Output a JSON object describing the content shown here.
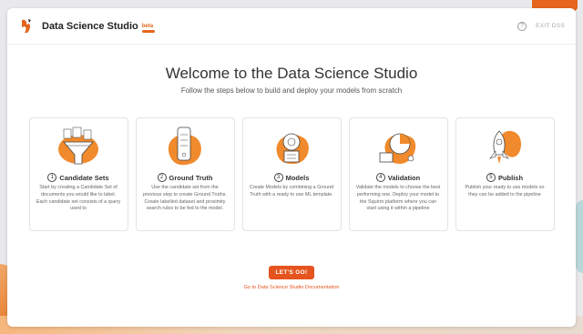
{
  "header": {
    "app_title": "Data Science Studio",
    "beta_label": "beta",
    "help_glyph": "?",
    "exit_label": "EXIT DSS"
  },
  "hero": {
    "title": "Welcome to the Data Science Studio",
    "subtitle": "Follow the steps below to build and deploy your models from scratch"
  },
  "steps": [
    {
      "number": "1",
      "title": "Candidate Sets",
      "icon": "candidate-sets-illustration",
      "description": "Start by creating a Candidate Set of documents you would like to label. Each candidate set consists of a query used to"
    },
    {
      "number": "2",
      "title": "Ground Truth",
      "icon": "ground-truth-illustration",
      "description": "Use the candidate set from the previous step to create Ground Truths. Create labelled dataset and proximity search rules to be fed to the model."
    },
    {
      "number": "3",
      "title": "Models",
      "icon": "models-illustration",
      "description": "Create Models by combining a Ground Truth with a ready to use ML template."
    },
    {
      "number": "4",
      "title": "Validation",
      "icon": "validation-illustration",
      "description": "Validate the models to choose the best performing one. Deploy your model to the Squirro platform where you can start using it within a pipeline"
    },
    {
      "number": "5",
      "title": "Publish",
      "icon": "publish-illustration",
      "description": "Publish your ready to use models so they can be added to the pipeline"
    }
  ],
  "cta": {
    "go_label": "LET'S GO!",
    "doc_link": "Go to Data Science Studio Documentation"
  },
  "colors": {
    "accent": "#e5541e",
    "blob": "#f08a2c"
  }
}
